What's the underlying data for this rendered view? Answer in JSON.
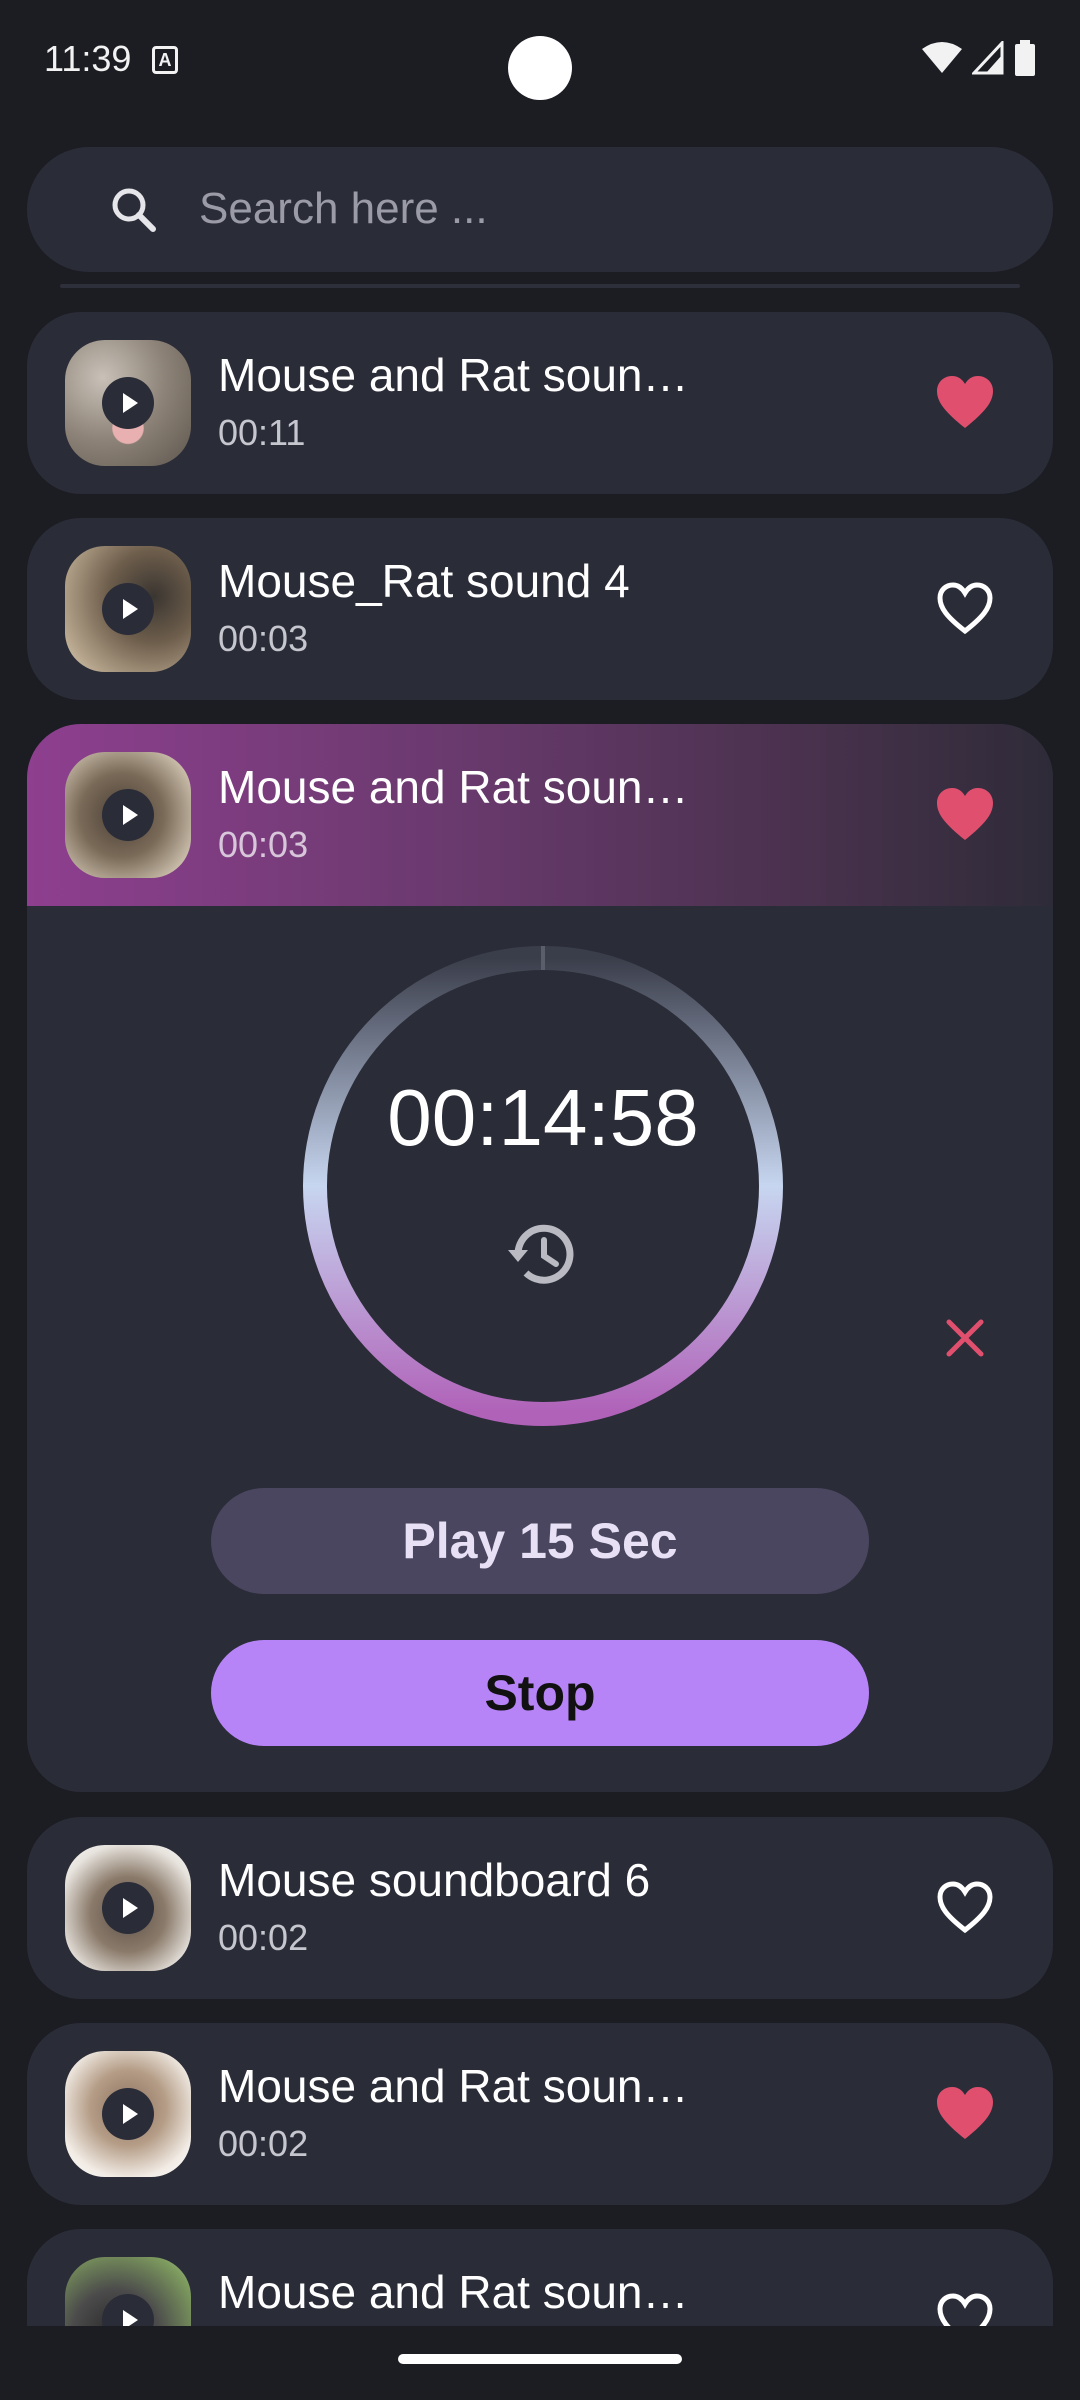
{
  "status_bar": {
    "time": "11:39",
    "notification_glyph": "A"
  },
  "search": {
    "placeholder": "Search here ..."
  },
  "sounds": [
    {
      "title": "Mouse and Rat soun…",
      "duration": "00:11",
      "favorite": true
    },
    {
      "title": "Mouse_Rat sound 4",
      "duration": "00:03",
      "favorite": false
    },
    {
      "title": "Mouse and Rat soun…",
      "duration": "00:03",
      "favorite": true
    },
    {
      "title": "Mouse soundboard 6",
      "duration": "00:02",
      "favorite": false
    },
    {
      "title": "Mouse and Rat soun…",
      "duration": "00:02",
      "favorite": true
    },
    {
      "title": "Mouse and Rat soun…",
      "duration": "",
      "favorite": false
    }
  ],
  "player": {
    "timer": "00:14:58",
    "play_button": "Play 15 Sec",
    "stop_button": "Stop"
  },
  "colors": {
    "accent_pink": "#e0506e",
    "accent_purple": "#b784f7",
    "card_bg": "#2a2c38"
  },
  "icons": [
    "search-icon",
    "play-icon",
    "heart-icon",
    "history-icon",
    "close-icon",
    "wifi-icon",
    "signal-icon",
    "battery-icon"
  ]
}
